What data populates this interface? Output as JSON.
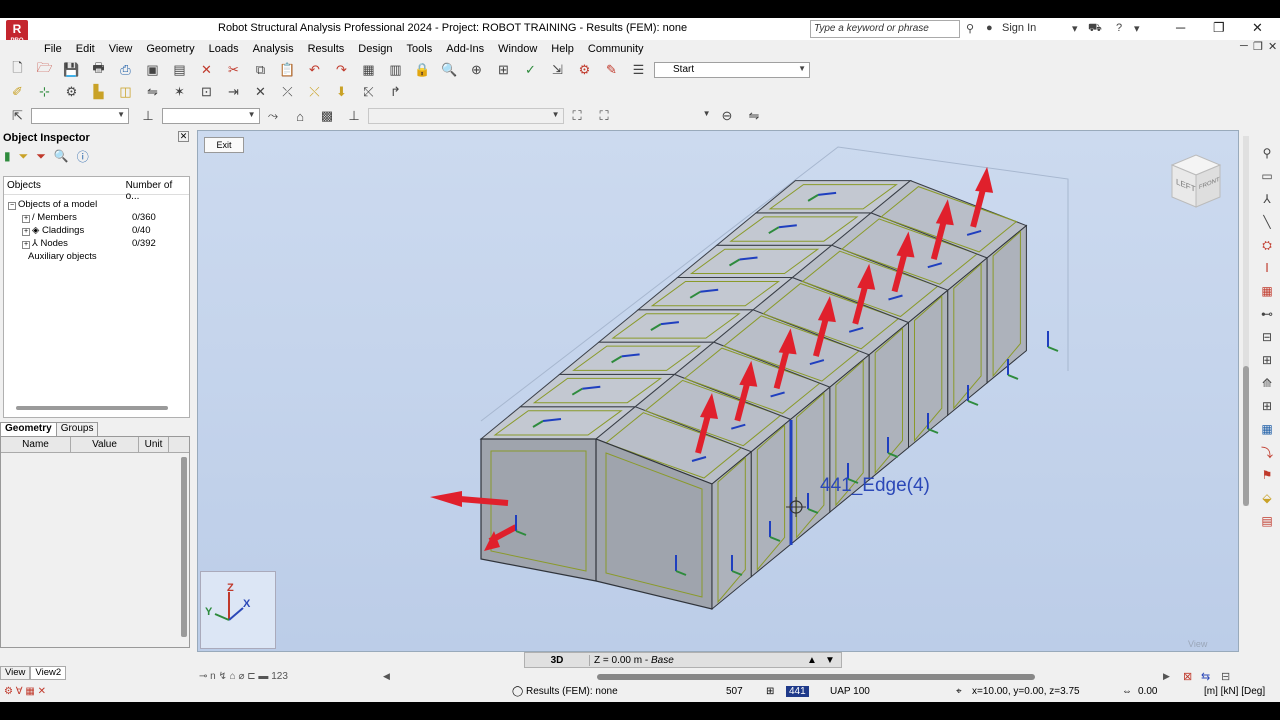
{
  "app": {
    "logo_letter": "R",
    "logo_sub": "PRO",
    "title": "Robot Structural Analysis Professional 2024 - Project: ROBOT TRAINING - Results (FEM): none",
    "search_placeholder": "Type a keyword or phrase",
    "sign_in": "Sign In"
  },
  "menu": [
    "File",
    "Edit",
    "View",
    "Geometry",
    "Loads",
    "Analysis",
    "Results",
    "Design",
    "Tools",
    "Add-Ins",
    "Window",
    "Help",
    "Community"
  ],
  "toolbar": {
    "start_combo": "Start"
  },
  "inspector": {
    "title": "Object Inspector",
    "col_objects": "Objects",
    "col_number": "Number of o...",
    "root": "Objects of a model",
    "items": [
      {
        "label": "Members",
        "value": "0/360"
      },
      {
        "label": "Claddings",
        "value": "0/40"
      },
      {
        "label": "Nodes",
        "value": "0/392"
      }
    ],
    "auxiliary": "Auxiliary objects",
    "tabs": [
      "Geometry",
      "Groups"
    ],
    "prop_headers": [
      "Name",
      "Value",
      "Unit"
    ],
    "view_tabs": [
      "View",
      "View2"
    ]
  },
  "viewport": {
    "exit": "Exit",
    "edge_label": "441_Edge(4)",
    "watermark": "View",
    "cube_left": "LEFT",
    "cube_right": "FRONT",
    "axis_z": "Z",
    "axis_x": "X",
    "axis_y": "Y"
  },
  "viewbar": {
    "mode": "3D",
    "level": "Z = 0.00 m",
    "level_name": "Base"
  },
  "status": {
    "results": "Results (FEM): none",
    "count": "507",
    "selected": "441",
    "uap": "UAP 100",
    "coords": "x=10.00, y=0.00, z=3.75",
    "angle": "0.00",
    "units": "[m] [kN] [Deg]"
  }
}
